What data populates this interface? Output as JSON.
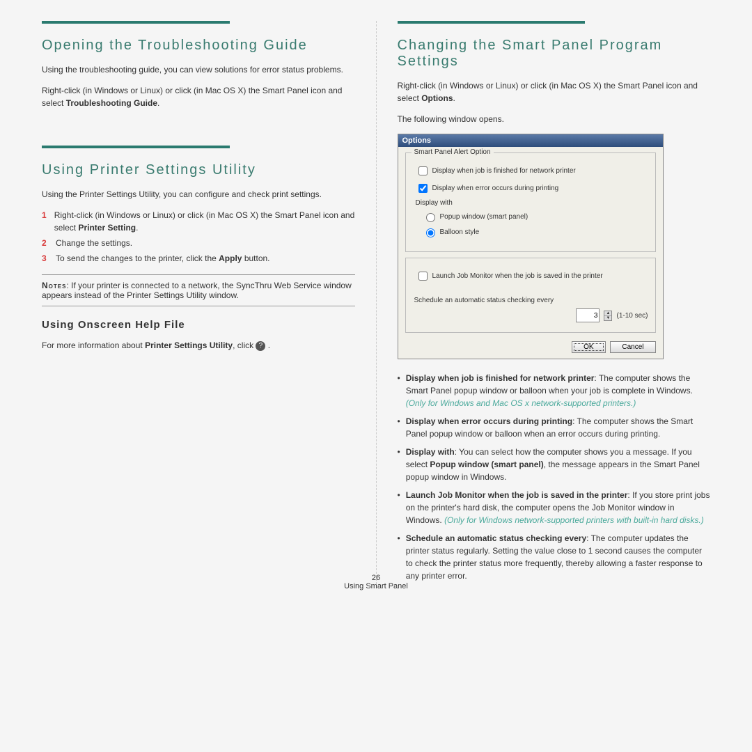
{
  "left": {
    "sec1": {
      "title": "Opening the Troubleshooting Guide",
      "p1": "Using the troubleshooting guide, you can view solutions for error status problems.",
      "p2_a": "Right-click (in Windows or Linux) or click (in Mac OS X) the Smart Panel icon and select ",
      "p2_b": "Troubleshooting Guide",
      "p2_c": "."
    },
    "sec2": {
      "title": "Using Printer Settings Utility",
      "p1": "Using the Printer Settings Utility, you can configure and check print settings.",
      "steps": [
        {
          "num": "1",
          "a": "Right-click (in Windows or Linux) or click (in Mac OS X) the Smart Panel icon and select ",
          "b": "Printer Setting",
          "c": "."
        },
        {
          "num": "2",
          "a": "Change the settings."
        },
        {
          "num": "3",
          "a": "To send the changes to the printer, click the ",
          "b": "Apply",
          "c": " button."
        }
      ],
      "note_label": "Notes",
      "note": ": If your printer is connected to a network, the SyncThru Web Service window appears instead of the Printer Settings Utility window.",
      "sub_title": "Using Onscreen Help File",
      "sub_p_a": "For more information about ",
      "sub_p_b": "Printer Settings Utility",
      "sub_p_c": ", click "
    }
  },
  "right": {
    "title": "Changing the Smart Panel Program Settings",
    "p1_a": "Right-click (in Windows or Linux) or click (in Mac OS X) the Smart Panel icon and select ",
    "p1_b": "Options",
    "p1_c": ".",
    "p2": "The following window opens.",
    "dialog": {
      "title": "Options",
      "group_label": "Smart Panel Alert Option",
      "cb1": "Display when job is finished for network printer",
      "cb2": "Display when error occurs during printing",
      "display_with": "Display with",
      "r1": "Popup window (smart panel)",
      "r2": "Balloon style",
      "cb3": "Launch Job Monitor when the job is saved in the printer",
      "sched": "Schedule an automatic status checking every",
      "sched_val": "3",
      "sched_range": "(1-10 sec)",
      "ok": "OK",
      "cancel": "Cancel"
    },
    "bullets": [
      {
        "b": "Display when job is finished for network printer",
        "txt": ": The computer shows the Smart Panel popup window or balloon when your job is complete in Windows. ",
        "em": "(Only for Windows and Mac OS x network-supported printers.)"
      },
      {
        "b": "Display when error occurs during printing",
        "txt": ": The computer shows the Smart Panel popup window or balloon when an error occurs during printing."
      },
      {
        "b": "Display with",
        "txt": ": You can select how the computer shows you a message. If you select ",
        "b2": "Popup window (smart panel)",
        "txt2": ", the message appears in the Smart Panel popup window in Windows."
      },
      {
        "b": "Launch Job Monitor when the job is saved in the printer",
        "txt": ": If you store print jobs on the printer's hard disk, the computer opens the Job Monitor window in Windows. ",
        "em": "(Only for Windows network-supported printers with built-in hard disks.)"
      },
      {
        "b": "Schedule an automatic status checking every",
        "txt": ": The computer updates the printer status regularly. Setting the value close to 1 second causes the computer to check the printer status more frequently, thereby allowing a faster response to any printer error."
      }
    ]
  },
  "footer": {
    "num": "26",
    "caption": "Using Smart Panel"
  }
}
